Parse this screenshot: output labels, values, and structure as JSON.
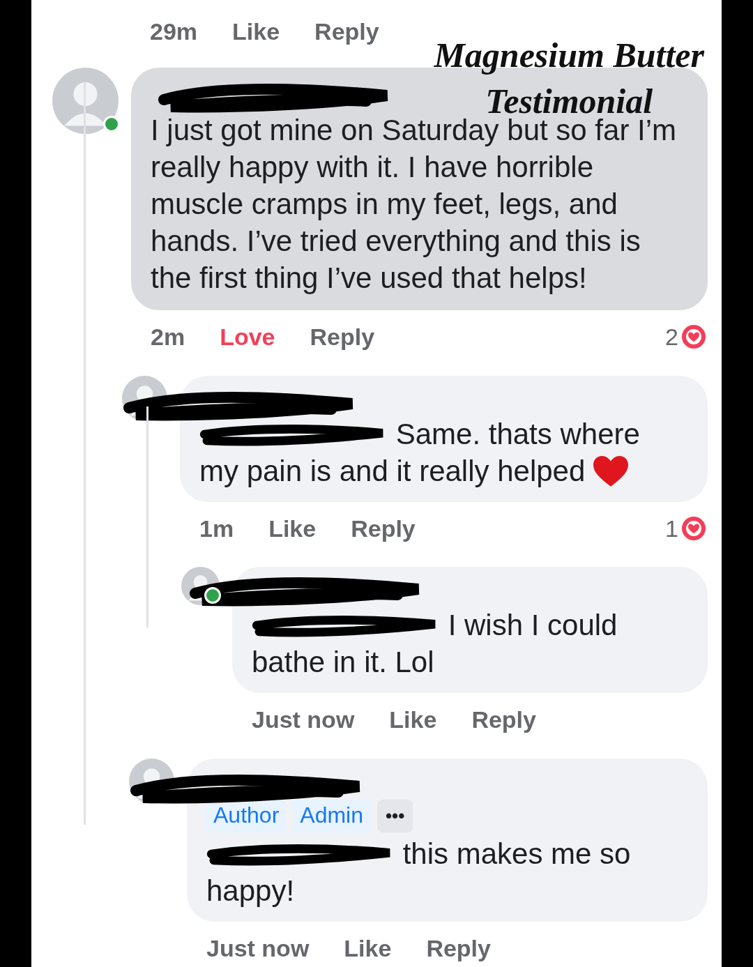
{
  "top_actions": {
    "time": "29m",
    "like": "Like",
    "reply": "Reply"
  },
  "overlay_title": [
    "Magnesium Butter",
    "Testimonial"
  ],
  "comments": [
    {
      "online": true,
      "highlighted": true,
      "text": "I just got mine on Saturday but so far I’m really happy with it. I have horrible muscle cramps in my feet, legs, and hands. I’ve tried everything and this is the first thing I’ve used that helps!",
      "time": "2m",
      "reaction_label": "Love",
      "reacted": true,
      "reply": "Reply",
      "reaction_count": "2",
      "children": [
        {
          "online": false,
          "highlighted": false,
          "text": "Same. thats where my pain is and it really helped",
          "heart_emoji": true,
          "time": "1m",
          "reaction_label": "Like",
          "reacted": false,
          "reply": "Reply",
          "reaction_count": "1",
          "children": [
            {
              "online": true,
              "highlighted": false,
              "text": "I wish I could bathe in it. Lol",
              "time": "Just now",
              "reaction_label": "Like",
              "reacted": false,
              "reply": "Reply"
            }
          ]
        },
        {
          "online": false,
          "highlighted": false,
          "badges": [
            "Author",
            "Admin"
          ],
          "more": "•••",
          "text": "this makes me so happy!",
          "time": "Just now",
          "reaction_label": "Like",
          "reacted": false,
          "reply": "Reply"
        }
      ]
    }
  ]
}
